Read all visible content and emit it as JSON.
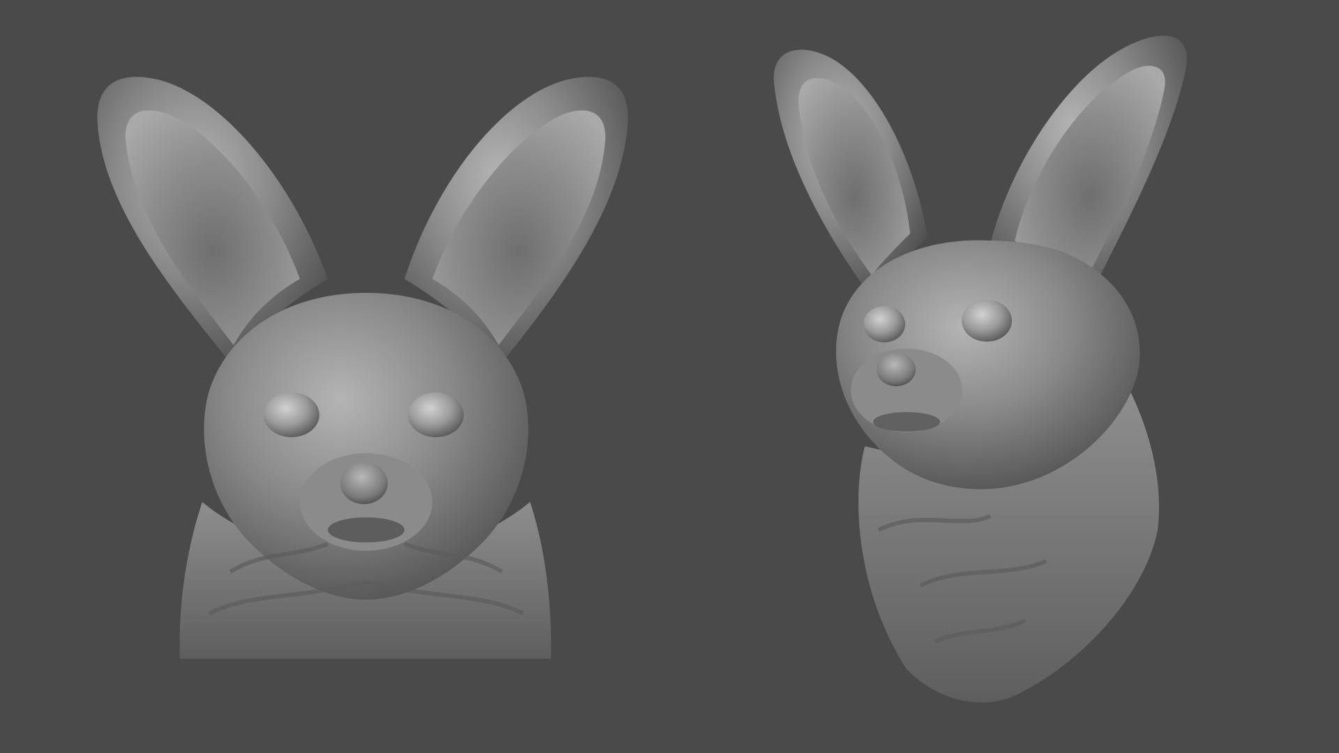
{
  "canvas": {
    "background": "#4a4a4a",
    "clay_light": "#a5a5a5",
    "clay_mid": "#7c7c7c",
    "clay_dark": "#3d3d3d",
    "clay_shadow": "#242424"
  },
  "subjects": [
    {
      "id": "front-view",
      "description": "fennec-fox-bust-front-view"
    },
    {
      "id": "three-quarter-view",
      "description": "fennec-fox-bust-three-quarter-view"
    }
  ]
}
